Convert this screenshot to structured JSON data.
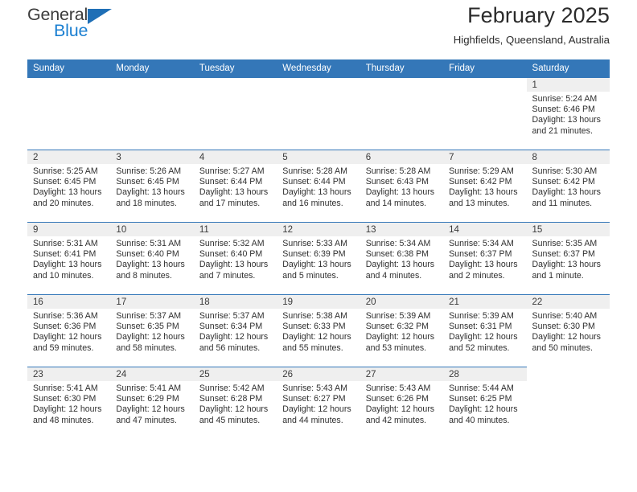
{
  "brand": {
    "name_top": "General",
    "name_bottom": "Blue",
    "triangle_icon": "blue-triangle-icon",
    "accent_color": "#1b7fd1"
  },
  "header": {
    "title": "February 2025",
    "location": "Highfields, Queensland, Australia",
    "header_bg_color": "#3477b8",
    "band_bg_color": "#efefef"
  },
  "calendar": {
    "weekday_headers": [
      "Sunday",
      "Monday",
      "Tuesday",
      "Wednesday",
      "Thursday",
      "Friday",
      "Saturday"
    ],
    "labels": {
      "sunrise": "Sunrise:",
      "sunset": "Sunset:",
      "daylight": "Daylight:"
    },
    "weeks": [
      [
        {
          "day": ""
        },
        {
          "day": ""
        },
        {
          "day": ""
        },
        {
          "day": ""
        },
        {
          "day": ""
        },
        {
          "day": ""
        },
        {
          "day": "1",
          "sunrise": "Sunrise: 5:24 AM",
          "sunset": "Sunset: 6:46 PM",
          "daylight_line1": "Daylight: 13 hours",
          "daylight_line2": "and 21 minutes."
        }
      ],
      [
        {
          "day": "2",
          "sunrise": "Sunrise: 5:25 AM",
          "sunset": "Sunset: 6:45 PM",
          "daylight_line1": "Daylight: 13 hours",
          "daylight_line2": "and 20 minutes."
        },
        {
          "day": "3",
          "sunrise": "Sunrise: 5:26 AM",
          "sunset": "Sunset: 6:45 PM",
          "daylight_line1": "Daylight: 13 hours",
          "daylight_line2": "and 18 minutes."
        },
        {
          "day": "4",
          "sunrise": "Sunrise: 5:27 AM",
          "sunset": "Sunset: 6:44 PM",
          "daylight_line1": "Daylight: 13 hours",
          "daylight_line2": "and 17 minutes."
        },
        {
          "day": "5",
          "sunrise": "Sunrise: 5:28 AM",
          "sunset": "Sunset: 6:44 PM",
          "daylight_line1": "Daylight: 13 hours",
          "daylight_line2": "and 16 minutes."
        },
        {
          "day": "6",
          "sunrise": "Sunrise: 5:28 AM",
          "sunset": "Sunset: 6:43 PM",
          "daylight_line1": "Daylight: 13 hours",
          "daylight_line2": "and 14 minutes."
        },
        {
          "day": "7",
          "sunrise": "Sunrise: 5:29 AM",
          "sunset": "Sunset: 6:42 PM",
          "daylight_line1": "Daylight: 13 hours",
          "daylight_line2": "and 13 minutes."
        },
        {
          "day": "8",
          "sunrise": "Sunrise: 5:30 AM",
          "sunset": "Sunset: 6:42 PM",
          "daylight_line1": "Daylight: 13 hours",
          "daylight_line2": "and 11 minutes."
        }
      ],
      [
        {
          "day": "9",
          "sunrise": "Sunrise: 5:31 AM",
          "sunset": "Sunset: 6:41 PM",
          "daylight_line1": "Daylight: 13 hours",
          "daylight_line2": "and 10 minutes."
        },
        {
          "day": "10",
          "sunrise": "Sunrise: 5:31 AM",
          "sunset": "Sunset: 6:40 PM",
          "daylight_line1": "Daylight: 13 hours",
          "daylight_line2": "and 8 minutes."
        },
        {
          "day": "11",
          "sunrise": "Sunrise: 5:32 AM",
          "sunset": "Sunset: 6:40 PM",
          "daylight_line1": "Daylight: 13 hours",
          "daylight_line2": "and 7 minutes."
        },
        {
          "day": "12",
          "sunrise": "Sunrise: 5:33 AM",
          "sunset": "Sunset: 6:39 PM",
          "daylight_line1": "Daylight: 13 hours",
          "daylight_line2": "and 5 minutes."
        },
        {
          "day": "13",
          "sunrise": "Sunrise: 5:34 AM",
          "sunset": "Sunset: 6:38 PM",
          "daylight_line1": "Daylight: 13 hours",
          "daylight_line2": "and 4 minutes."
        },
        {
          "day": "14",
          "sunrise": "Sunrise: 5:34 AM",
          "sunset": "Sunset: 6:37 PM",
          "daylight_line1": "Daylight: 13 hours",
          "daylight_line2": "and 2 minutes."
        },
        {
          "day": "15",
          "sunrise": "Sunrise: 5:35 AM",
          "sunset": "Sunset: 6:37 PM",
          "daylight_line1": "Daylight: 13 hours",
          "daylight_line2": "and 1 minute."
        }
      ],
      [
        {
          "day": "16",
          "sunrise": "Sunrise: 5:36 AM",
          "sunset": "Sunset: 6:36 PM",
          "daylight_line1": "Daylight: 12 hours",
          "daylight_line2": "and 59 minutes."
        },
        {
          "day": "17",
          "sunrise": "Sunrise: 5:37 AM",
          "sunset": "Sunset: 6:35 PM",
          "daylight_line1": "Daylight: 12 hours",
          "daylight_line2": "and 58 minutes."
        },
        {
          "day": "18",
          "sunrise": "Sunrise: 5:37 AM",
          "sunset": "Sunset: 6:34 PM",
          "daylight_line1": "Daylight: 12 hours",
          "daylight_line2": "and 56 minutes."
        },
        {
          "day": "19",
          "sunrise": "Sunrise: 5:38 AM",
          "sunset": "Sunset: 6:33 PM",
          "daylight_line1": "Daylight: 12 hours",
          "daylight_line2": "and 55 minutes."
        },
        {
          "day": "20",
          "sunrise": "Sunrise: 5:39 AM",
          "sunset": "Sunset: 6:32 PM",
          "daylight_line1": "Daylight: 12 hours",
          "daylight_line2": "and 53 minutes."
        },
        {
          "day": "21",
          "sunrise": "Sunrise: 5:39 AM",
          "sunset": "Sunset: 6:31 PM",
          "daylight_line1": "Daylight: 12 hours",
          "daylight_line2": "and 52 minutes."
        },
        {
          "day": "22",
          "sunrise": "Sunrise: 5:40 AM",
          "sunset": "Sunset: 6:30 PM",
          "daylight_line1": "Daylight: 12 hours",
          "daylight_line2": "and 50 minutes."
        }
      ],
      [
        {
          "day": "23",
          "sunrise": "Sunrise: 5:41 AM",
          "sunset": "Sunset: 6:30 PM",
          "daylight_line1": "Daylight: 12 hours",
          "daylight_line2": "and 48 minutes."
        },
        {
          "day": "24",
          "sunrise": "Sunrise: 5:41 AM",
          "sunset": "Sunset: 6:29 PM",
          "daylight_line1": "Daylight: 12 hours",
          "daylight_line2": "and 47 minutes."
        },
        {
          "day": "25",
          "sunrise": "Sunrise: 5:42 AM",
          "sunset": "Sunset: 6:28 PM",
          "daylight_line1": "Daylight: 12 hours",
          "daylight_line2": "and 45 minutes."
        },
        {
          "day": "26",
          "sunrise": "Sunrise: 5:43 AM",
          "sunset": "Sunset: 6:27 PM",
          "daylight_line1": "Daylight: 12 hours",
          "daylight_line2": "and 44 minutes."
        },
        {
          "day": "27",
          "sunrise": "Sunrise: 5:43 AM",
          "sunset": "Sunset: 6:26 PM",
          "daylight_line1": "Daylight: 12 hours",
          "daylight_line2": "and 42 minutes."
        },
        {
          "day": "28",
          "sunrise": "Sunrise: 5:44 AM",
          "sunset": "Sunset: 6:25 PM",
          "daylight_line1": "Daylight: 12 hours",
          "daylight_line2": "and 40 minutes."
        },
        {
          "day": ""
        }
      ]
    ]
  }
}
